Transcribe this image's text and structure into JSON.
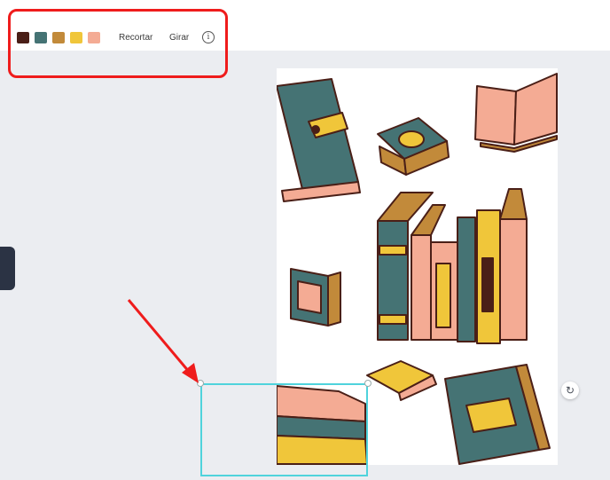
{
  "toolbar": {
    "colors": [
      "#4a1f17",
      "#457374",
      "#c28a3a",
      "#f0c63a",
      "#f4ab94"
    ],
    "crop_label": "Recortar",
    "rotate_label": "Girar",
    "info_icon": "info-icon"
  },
  "page_actions": {
    "icons": [
      "comment-icon",
      "duplicate-icon",
      "share-icon"
    ]
  },
  "canvas": {
    "rotate_icon": "rotate-icon",
    "rotate_glyph": "↻"
  },
  "annotations": {
    "highlight_color": "#ef1c1c",
    "arrow_color": "#ef1c1c",
    "selection_color": "#4fd3dc"
  },
  "illustration": {
    "palette": {
      "teal": "#457374",
      "brown_dark": "#4a1f17",
      "brown": "#c28a3a",
      "yellow": "#f0c63a",
      "pink": "#f4ab94"
    }
  }
}
